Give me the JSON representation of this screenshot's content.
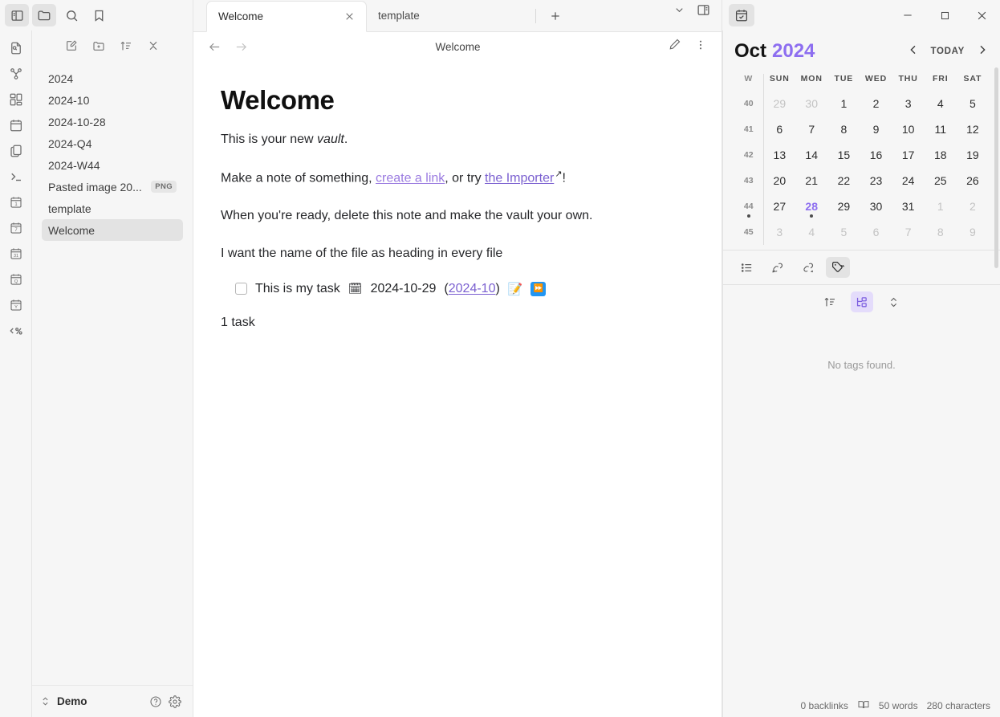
{
  "window": {
    "left_titlebar_buttons": [
      {
        "name": "toggle-left-sidebar",
        "icon": "sidebar-left-icon",
        "active": true
      },
      {
        "name": "files",
        "icon": "folder-icon",
        "active": true
      },
      {
        "name": "search",
        "icon": "search-icon",
        "active": false
      },
      {
        "name": "bookmarks",
        "icon": "bookmark-icon",
        "active": false
      }
    ],
    "controls": {
      "minimize": "–",
      "maximize": "□",
      "close": "✕"
    },
    "right_tab_icon": "calendar-check-icon"
  },
  "ribbon": {
    "items": [
      {
        "label": "Quick switcher",
        "icon": "file-search-icon"
      },
      {
        "label": "Graph view",
        "icon": "graph-icon"
      },
      {
        "label": "Canvas",
        "icon": "canvas-grid-icon"
      },
      {
        "label": "Daily note",
        "icon": "calendar-icon"
      },
      {
        "label": "Templates",
        "icon": "copy-files-icon"
      },
      {
        "label": "Terminal",
        "icon": "terminal-icon"
      },
      {
        "label": "Open daily note",
        "icon": "calendar-1-icon"
      },
      {
        "label": "Open weekly note",
        "icon": "calendar-7-icon"
      },
      {
        "label": "Open monthly note",
        "icon": "calendar-31-icon"
      },
      {
        "label": "Open quarterly note",
        "icon": "calendar-q-icon"
      },
      {
        "label": "Open yearly note",
        "icon": "calendar-y-icon"
      },
      {
        "label": "Templater",
        "icon": "templater-icon"
      }
    ]
  },
  "explorer": {
    "toolbar": [
      {
        "name": "new-note-button",
        "icon": "pencil-square-icon"
      },
      {
        "name": "new-folder-button",
        "icon": "folder-plus-icon"
      },
      {
        "name": "sort-button",
        "icon": "sort-asc-icon"
      },
      {
        "name": "collapse-all-button",
        "icon": "collapse-icon"
      }
    ],
    "files": [
      {
        "name": "2024",
        "badge": "",
        "selected": false
      },
      {
        "name": "2024-10",
        "badge": "",
        "selected": false
      },
      {
        "name": "2024-10-28",
        "badge": "",
        "selected": false
      },
      {
        "name": "2024-Q4",
        "badge": "",
        "selected": false
      },
      {
        "name": "2024-W44",
        "badge": "",
        "selected": false
      },
      {
        "name": "Pasted image 20...",
        "badge": "PNG",
        "selected": false
      },
      {
        "name": "template",
        "badge": "",
        "selected": false
      },
      {
        "name": "Welcome",
        "badge": "",
        "selected": true
      }
    ]
  },
  "vault": {
    "name": "Demo",
    "switch_icon": "vault-switch-icon",
    "help_icon": "help-circle-icon",
    "settings_icon": "gear-icon"
  },
  "tabs": {
    "items": [
      {
        "title": "Welcome",
        "active": true
      },
      {
        "title": "template",
        "active": false
      }
    ],
    "add_label": "+",
    "dropdown_icon": "chevron-down-icon",
    "right_sidebar_icon": "sidebar-right-icon"
  },
  "viewheader": {
    "back_icon": "arrow-left-icon",
    "forward_icon": "arrow-right-icon",
    "title": "Welcome",
    "edit_icon": "pencil-icon",
    "more_icon": "more-vertical-icon"
  },
  "document": {
    "heading": "Welcome",
    "p1_a": "This is your new ",
    "p1_em": "vault",
    "p1_b": ".",
    "p2_a": "Make a note of something, ",
    "p2_link1": "create a link",
    "p2_b": ", or try ",
    "p2_link2": "the Importer",
    "p2_ext": "↗",
    "p2_c": "!",
    "p3": "When you're ready, delete this note and make the vault your own.",
    "p4": "I want the name of the file as heading in every file",
    "task": {
      "text": "This is my task",
      "calendar_emoji": "🗓",
      "date": "2024-10-29",
      "link_open": "(",
      "link": "2024-10",
      "link_close": ")",
      "memo_emoji": "📝",
      "forward_glyph": "⏩"
    },
    "task_count": "1 task"
  },
  "calendar": {
    "month": "Oct",
    "year": "2024",
    "prev_icon": "chevron-left-icon",
    "today_label": "TODAY",
    "next_icon": "chevron-right-icon",
    "accent_color": "#8d6ef0",
    "headers": [
      "W",
      "SUN",
      "MON",
      "TUE",
      "WED",
      "THU",
      "FRI",
      "SAT"
    ],
    "weeks": [
      {
        "w": "40",
        "w_dot": false,
        "days": [
          {
            "n": "29",
            "adj": true,
            "today": false,
            "dot": false
          },
          {
            "n": "30",
            "adj": true,
            "today": false,
            "dot": false
          },
          {
            "n": "1",
            "adj": false,
            "today": false,
            "dot": false
          },
          {
            "n": "2",
            "adj": false,
            "today": false,
            "dot": false
          },
          {
            "n": "3",
            "adj": false,
            "today": false,
            "dot": false
          },
          {
            "n": "4",
            "adj": false,
            "today": false,
            "dot": false
          },
          {
            "n": "5",
            "adj": false,
            "today": false,
            "dot": false
          }
        ]
      },
      {
        "w": "41",
        "w_dot": false,
        "days": [
          {
            "n": "6",
            "adj": false,
            "today": false,
            "dot": false
          },
          {
            "n": "7",
            "adj": false,
            "today": false,
            "dot": false
          },
          {
            "n": "8",
            "adj": false,
            "today": false,
            "dot": false
          },
          {
            "n": "9",
            "adj": false,
            "today": false,
            "dot": false
          },
          {
            "n": "10",
            "adj": false,
            "today": false,
            "dot": false
          },
          {
            "n": "11",
            "adj": false,
            "today": false,
            "dot": false
          },
          {
            "n": "12",
            "adj": false,
            "today": false,
            "dot": false
          }
        ]
      },
      {
        "w": "42",
        "w_dot": false,
        "days": [
          {
            "n": "13",
            "adj": false,
            "today": false,
            "dot": false
          },
          {
            "n": "14",
            "adj": false,
            "today": false,
            "dot": false
          },
          {
            "n": "15",
            "adj": false,
            "today": false,
            "dot": false
          },
          {
            "n": "16",
            "adj": false,
            "today": false,
            "dot": false
          },
          {
            "n": "17",
            "adj": false,
            "today": false,
            "dot": false
          },
          {
            "n": "18",
            "adj": false,
            "today": false,
            "dot": false
          },
          {
            "n": "19",
            "adj": false,
            "today": false,
            "dot": false
          }
        ]
      },
      {
        "w": "43",
        "w_dot": false,
        "days": [
          {
            "n": "20",
            "adj": false,
            "today": false,
            "dot": false
          },
          {
            "n": "21",
            "adj": false,
            "today": false,
            "dot": false
          },
          {
            "n": "22",
            "adj": false,
            "today": false,
            "dot": false
          },
          {
            "n": "23",
            "adj": false,
            "today": false,
            "dot": false
          },
          {
            "n": "24",
            "adj": false,
            "today": false,
            "dot": false
          },
          {
            "n": "25",
            "adj": false,
            "today": false,
            "dot": false
          },
          {
            "n": "26",
            "adj": false,
            "today": false,
            "dot": false
          }
        ]
      },
      {
        "w": "44",
        "w_dot": true,
        "days": [
          {
            "n": "27",
            "adj": false,
            "today": false,
            "dot": false
          },
          {
            "n": "28",
            "adj": false,
            "today": true,
            "dot": true
          },
          {
            "n": "29",
            "adj": false,
            "today": false,
            "dot": false
          },
          {
            "n": "30",
            "adj": false,
            "today": false,
            "dot": false
          },
          {
            "n": "31",
            "adj": false,
            "today": false,
            "dot": false
          },
          {
            "n": "1",
            "adj": true,
            "today": false,
            "dot": false
          },
          {
            "n": "2",
            "adj": true,
            "today": false,
            "dot": false
          }
        ]
      },
      {
        "w": "45",
        "w_dot": false,
        "days": [
          {
            "n": "3",
            "adj": true,
            "today": false,
            "dot": false
          },
          {
            "n": "4",
            "adj": true,
            "today": false,
            "dot": false
          },
          {
            "n": "5",
            "adj": true,
            "today": false,
            "dot": false
          },
          {
            "n": "6",
            "adj": true,
            "today": false,
            "dot": false
          },
          {
            "n": "7",
            "adj": true,
            "today": false,
            "dot": false
          },
          {
            "n": "8",
            "adj": true,
            "today": false,
            "dot": false
          },
          {
            "n": "9",
            "adj": true,
            "today": false,
            "dot": false
          }
        ]
      }
    ]
  },
  "side_panes": {
    "tabs": [
      {
        "name": "outline",
        "icon": "list-icon",
        "active": false
      },
      {
        "name": "backlinks",
        "icon": "link-in-icon",
        "active": false
      },
      {
        "name": "outgoing-links",
        "icon": "link-out-icon",
        "active": false
      },
      {
        "name": "tags",
        "icon": "tags-icon",
        "active": true
      }
    ],
    "tag_toolbar": [
      {
        "name": "change-sort-order",
        "icon": "sort-asc-icon",
        "active": false
      },
      {
        "name": "nested-tags",
        "icon": "tree-icon",
        "active": true
      },
      {
        "name": "expand-collapse",
        "icon": "chevrons-updown-icon",
        "active": false
      }
    ],
    "empty_message": "No tags found."
  },
  "status": {
    "backlinks": "0 backlinks",
    "reading_icon": "book-open-icon",
    "words": "50 words",
    "characters": "280 characters"
  }
}
